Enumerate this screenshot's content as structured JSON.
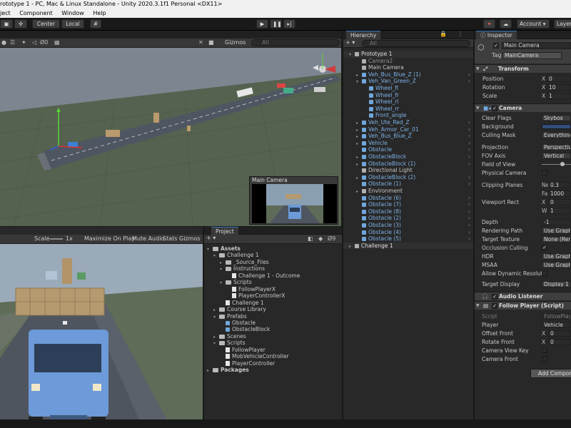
{
  "window": {
    "title": "rototype 1 - PC, Mac & Linux Standalone - Unity 2020.3.1f1 Personal <DX11>"
  },
  "menu": [
    "ject",
    "Component",
    "Window",
    "Help"
  ],
  "toolbar": {
    "pivot": "Center",
    "space": "Local",
    "account": "Account",
    "layers": "Layer"
  },
  "scene": {
    "gizmos": "Gizmos",
    "search_placeholder": "All",
    "persp_label": "Persp"
  },
  "camera_preview": {
    "title": "Main Camera"
  },
  "game": {
    "scale_label": "Scale",
    "scale_value": "1x",
    "maximize": "Maximize On Play",
    "mute": "Mute Audio",
    "stats": "Stats",
    "gizmos": "Gizmos"
  },
  "project": {
    "tab": "Project",
    "items": [
      {
        "depth": 0,
        "label": "Assets",
        "kind": "folder",
        "bold": true
      },
      {
        "depth": 1,
        "label": "Challenge 1",
        "kind": "folder"
      },
      {
        "depth": 2,
        "label": "_Source_Files",
        "kind": "folder"
      },
      {
        "depth": 2,
        "label": "Instructions",
        "kind": "folder"
      },
      {
        "depth": 3,
        "label": "Challenge 1 - Outcome",
        "kind": "file"
      },
      {
        "depth": 2,
        "label": "Scripts",
        "kind": "folder"
      },
      {
        "depth": 3,
        "label": "FollowPlayerX",
        "kind": "file"
      },
      {
        "depth": 3,
        "label": "PlayerControllerX",
        "kind": "file"
      },
      {
        "depth": 2,
        "label": "Challenge 1",
        "kind": "file"
      },
      {
        "depth": 1,
        "label": "Course Library",
        "kind": "folder"
      },
      {
        "depth": 1,
        "label": "Prefabs",
        "kind": "folder"
      },
      {
        "depth": 2,
        "label": "Obstacle",
        "kind": "cube"
      },
      {
        "depth": 2,
        "label": "ObstacleBlock",
        "kind": "cube"
      },
      {
        "depth": 1,
        "label": "Scenes",
        "kind": "folder"
      },
      {
        "depth": 1,
        "label": "Scripts",
        "kind": "folder"
      },
      {
        "depth": 2,
        "label": "FollowPlayer",
        "kind": "file"
      },
      {
        "depth": 2,
        "label": "MobVehicleController",
        "kind": "file"
      },
      {
        "depth": 2,
        "label": "PlayerController",
        "kind": "file"
      },
      {
        "depth": 0,
        "label": "Packages",
        "kind": "folder",
        "bold": true
      }
    ]
  },
  "hierarchy": {
    "tab": "Hierarchy",
    "search_placeholder": "All",
    "items": [
      {
        "depth": 0,
        "label": "Prototype 1",
        "style": "scene"
      },
      {
        "depth": 1,
        "label": "Camera2",
        "style": "dim"
      },
      {
        "depth": 1,
        "label": "Main Camera",
        "style": "normal"
      },
      {
        "depth": 1,
        "label": "Veh_Bus_Blue_Z (1)",
        "style": "blue"
      },
      {
        "depth": 1,
        "label": "Veh_Van_Green_Z",
        "style": "blue"
      },
      {
        "depth": 2,
        "label": "Wheel_fl",
        "style": "blue"
      },
      {
        "depth": 2,
        "label": "Wheel_fr",
        "style": "blue"
      },
      {
        "depth": 2,
        "label": "Wheel_rl",
        "style": "blue"
      },
      {
        "depth": 2,
        "label": "Wheel_rr",
        "style": "blue"
      },
      {
        "depth": 2,
        "label": "Front_angle",
        "style": "blue"
      },
      {
        "depth": 1,
        "label": "Veh_Ute_Red_Z",
        "style": "blue"
      },
      {
        "depth": 1,
        "label": "Veh_Armor_Car_01",
        "style": "blue"
      },
      {
        "depth": 1,
        "label": "Veh_Bus_Blue_Z",
        "style": "blue"
      },
      {
        "depth": 1,
        "label": "Vehicle",
        "style": "blue"
      },
      {
        "depth": 1,
        "label": "Obstacle",
        "style": "blue"
      },
      {
        "depth": 1,
        "label": "ObstacleBlock",
        "style": "blue"
      },
      {
        "depth": 1,
        "label": "ObstacleBlock (1)",
        "style": "blue"
      },
      {
        "depth": 1,
        "label": "Directional Light",
        "style": "normal"
      },
      {
        "depth": 1,
        "label": "ObstacleBlock (2)",
        "style": "blue"
      },
      {
        "depth": 1,
        "label": "Obstacle (1)",
        "style": "blue"
      },
      {
        "depth": 1,
        "label": "Environment",
        "style": "normal"
      },
      {
        "depth": 1,
        "label": "Obstacle (6)",
        "style": "blue"
      },
      {
        "depth": 1,
        "label": "Obstacle (7)",
        "style": "blue"
      },
      {
        "depth": 1,
        "label": "Obstacle (8)",
        "style": "blue"
      },
      {
        "depth": 1,
        "label": "Obstacle (2)",
        "style": "blue"
      },
      {
        "depth": 1,
        "label": "Obstacle (3)",
        "style": "blue"
      },
      {
        "depth": 1,
        "label": "Obstacle (4)",
        "style": "blue"
      },
      {
        "depth": 1,
        "label": "Obstacle (5)",
        "style": "blue"
      },
      {
        "depth": 0,
        "label": "Challenge 1",
        "style": "scene"
      }
    ]
  },
  "inspector": {
    "tab": "Inspector",
    "object_name": "Main Camera",
    "tag_label": "Tag",
    "tag_value": "MainCamera",
    "transform": {
      "title": "Transform",
      "position": "Position",
      "rotation": "Rotation",
      "scale": "Scale",
      "px": "0",
      "rx": "10",
      "sx": "1",
      "axis_x": "X"
    },
    "camera": {
      "title": "Camera",
      "clear_flags": "Clear Flags",
      "clear_flags_value": "Skybox",
      "background": "Background",
      "culling_mask": "Culling Mask",
      "culling_mask_value": "Everything",
      "projection": "Projection",
      "projection_value": "Perspective",
      "fov_axis": "FOV Axis",
      "fov_axis_value": "Vertical",
      "fov": "Field of View",
      "physical": "Physical Camera",
      "clipping": "Clipping Planes",
      "near": "Near",
      "near_value": "0.3",
      "far": "Far",
      "far_value": "1000",
      "viewport": "Viewport Rect",
      "vx": "0",
      "vw": "1",
      "axis_x": "X",
      "axis_w": "W",
      "depth": "Depth",
      "depth_value": "-1",
      "rendering_path": "Rendering Path",
      "rendering_path_value": "Use Graphics",
      "target_texture": "Target Texture",
      "target_texture_value": "None (Rend",
      "occlusion": "Occlusion Culling",
      "hdr": "HDR",
      "hdr_value": "Use Graphics",
      "msaa": "MSAA",
      "msaa_value": "Use Graphics",
      "dyn_res": "Allow Dynamic Resolutio",
      "target_display": "Target Display",
      "target_display_value": "Display 1"
    },
    "audio_listener": "Audio Listener",
    "follow": {
      "title": "Follow Player (Script)",
      "script": "Script",
      "script_value": "FollowPlay",
      "player": "Player",
      "player_value": "Vehicle",
      "offset_front": "Offset Front",
      "ofx": "0",
      "rotate_front": "Rotate Front",
      "rfx": "0",
      "camera_view_key": "Camera View Key",
      "camera_front": "Camera Front",
      "axis_x": "X"
    },
    "add_component": "Add Compone"
  }
}
